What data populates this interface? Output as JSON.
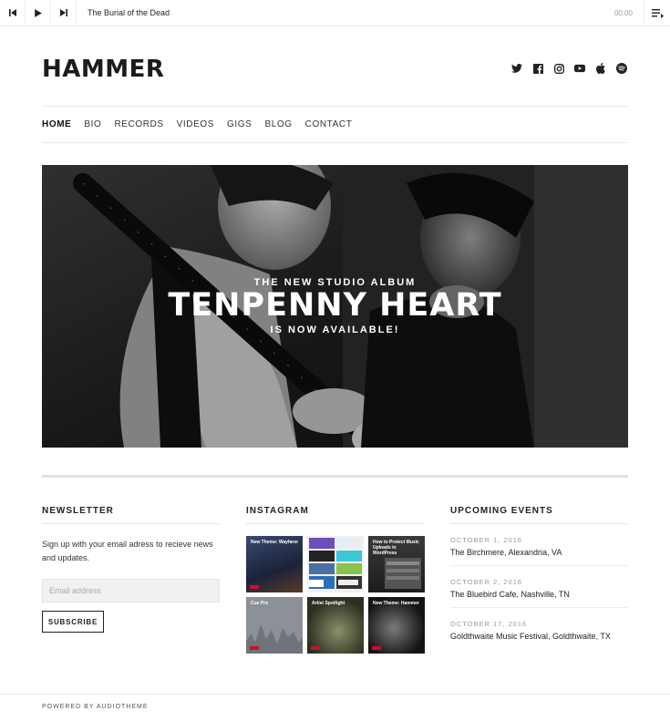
{
  "player": {
    "track_title": "The Burial of the Dead",
    "time": "00:00",
    "controls": [
      "previous-icon",
      "play-icon",
      "next-icon",
      "playlist-icon"
    ]
  },
  "site": {
    "logo": "HAMMER",
    "social": [
      "twitter-icon",
      "facebook-icon",
      "instagram-icon",
      "youtube-icon",
      "apple-icon",
      "spotify-icon"
    ]
  },
  "nav": {
    "items": [
      "HOME",
      "BIO",
      "RECORDS",
      "VIDEOS",
      "GIGS",
      "BLOG",
      "CONTACT"
    ],
    "active": "HOME"
  },
  "hero": {
    "subtitle": "THE NEW STUDIO ALBUM",
    "title": "TENPENNY HEART",
    "tagline": "IS NOW AVAILABLE!"
  },
  "newsletter": {
    "heading": "NEWSLETTER",
    "text": "Sign up with your email adress to recieve news and updates.",
    "placeholder": "Email address",
    "button": "SUBSCRIBE"
  },
  "instagram": {
    "heading": "INSTAGRAM",
    "tiles": [
      {
        "caption": "New Theme: Wayfarer",
        "color": "#2c3b5e"
      },
      {
        "caption": "",
        "color": "#e9eef2"
      },
      {
        "caption": "How to Protect Music Uploads in WordPress",
        "color": "#2d2d2d"
      },
      {
        "caption": "Cue Pro",
        "color": "#8a8f96"
      },
      {
        "caption": "Artist Spotlight",
        "color": "#4a5033"
      },
      {
        "caption": "New Theme: Hammer",
        "color": "#1d1d1d"
      }
    ]
  },
  "events": {
    "heading": "UPCOMING EVENTS",
    "items": [
      {
        "date": "OCTOBER 1, 2016",
        "name": "The Birchmere, Alexandria, VA"
      },
      {
        "date": "OCTOBER 2, 2016",
        "name": "The Bluebird Cafe, Nashville, TN"
      },
      {
        "date": "OCTOBER 17, 2016",
        "name": "Goldthwaite Music Festival, Goldthwaite, TX"
      }
    ]
  },
  "footer": {
    "powered": "POWERED BY AUDIOTHEME"
  }
}
